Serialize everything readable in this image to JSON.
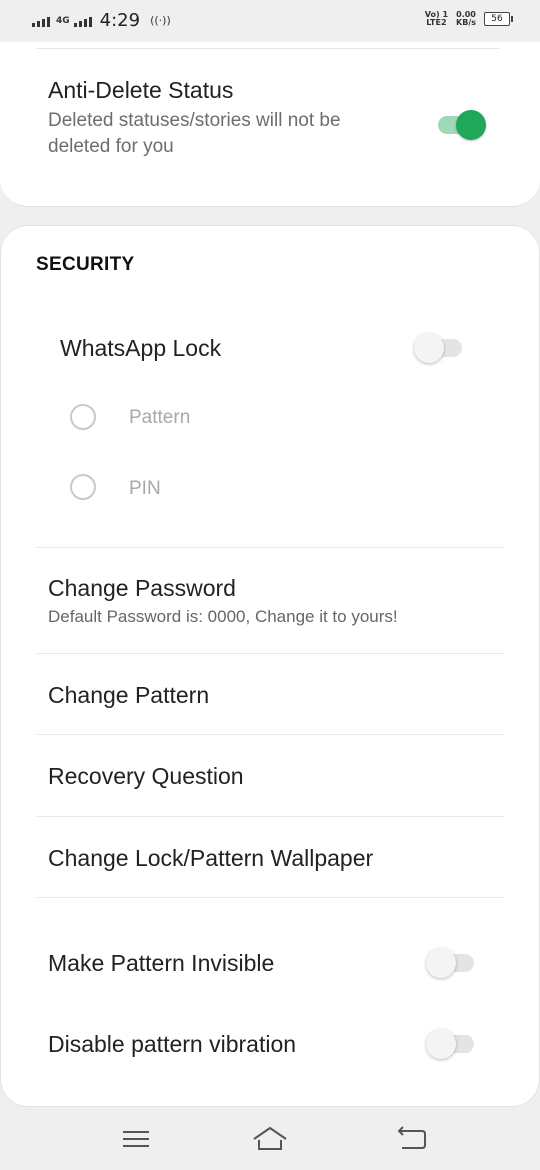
{
  "status_bar": {
    "network": "4G",
    "time": "4:29",
    "volte": "Vo) 1",
    "lte": "LTE2",
    "speed_value": "0.00",
    "speed_unit": "KB/s",
    "battery": "56"
  },
  "privacy": {
    "anti_delete_status": {
      "title": "Anti-Delete Status",
      "description": "Deleted statuses/stories will not be deleted for you",
      "enabled": true
    }
  },
  "security": {
    "section_title": "SECURITY",
    "whatsapp_lock": {
      "label": "WhatsApp Lock",
      "enabled": false
    },
    "lock_options": [
      {
        "label": "Pattern",
        "selected": false
      },
      {
        "label": "PIN",
        "selected": false
      }
    ],
    "change_password": {
      "label": "Change Password",
      "description": "Default Password is: 0000, Change it to yours!"
    },
    "change_pattern": {
      "label": "Change Pattern"
    },
    "recovery_question": {
      "label": "Recovery Question"
    },
    "change_wallpaper": {
      "label": "Change Lock/Pattern Wallpaper"
    },
    "make_pattern_invisible": {
      "label": "Make Pattern Invisible",
      "enabled": false
    },
    "disable_pattern_vibration": {
      "label": "Disable pattern vibration",
      "enabled": false
    }
  },
  "nav_bar": {
    "icons": [
      "menu-icon",
      "home-icon",
      "back-icon"
    ]
  },
  "colors": {
    "accent": "#1fa85a",
    "accent_track": "#9fd9b6",
    "background": "#efefef",
    "card": "#ffffff"
  }
}
